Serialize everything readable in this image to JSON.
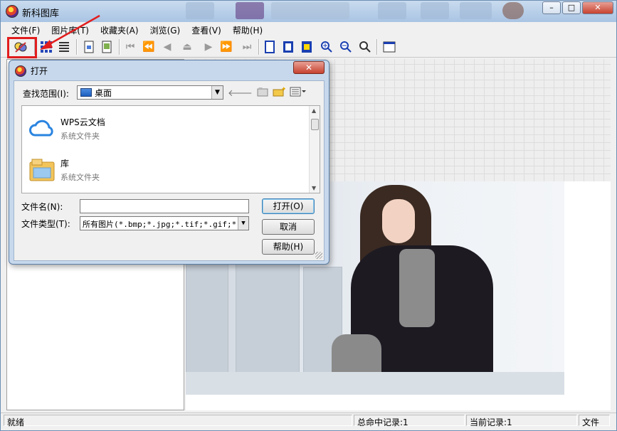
{
  "window": {
    "title": "新科图库",
    "controls": {
      "minimize": "–",
      "maximize": "□",
      "close": "✕"
    }
  },
  "menu": [
    "文件(F)",
    "图片库(T)",
    "收藏夹(A)",
    "浏览(G)",
    "查看(V)",
    "帮助(H)"
  ],
  "toolbar": {
    "icons": [
      "open-icon",
      "thumbnails-icon",
      "list-view-icon",
      "doc-icon",
      "doc2-icon",
      "first-icon",
      "prev-fast-icon",
      "prev-icon",
      "stop-icon",
      "next-icon",
      "next-fast-icon",
      "last-icon",
      "page-icon",
      "page-b-icon",
      "page-c-icon",
      "zoom-in-icon",
      "zoom-out-icon",
      "zoom-icon",
      "screen-icon"
    ]
  },
  "dialog": {
    "title": "打开",
    "close": "✕",
    "look_in_label": "查找范围(I):",
    "look_in_value": "桌面",
    "items": [
      {
        "name": "WPS云文档",
        "type": "系统文件夹",
        "icon": "cloud-icon"
      },
      {
        "name": "库",
        "type": "系统文件夹",
        "icon": "library-folder-icon"
      }
    ],
    "filename_label": "文件名(N):",
    "filename_value": "",
    "filetype_label": "文件类型(T):",
    "filetype_value": "所有图片(*.bmp;*.jpg;*.tif;*.gif;*.p",
    "open_button": "打开(O)",
    "cancel_button": "取消",
    "help_button": "帮助(H)"
  },
  "status": {
    "ready": "就绪",
    "total_records": "总命中记录:1",
    "current_record": "当前记录:1",
    "mode": "文件"
  },
  "colors": {
    "highlight": "#e21d1d",
    "title_bar": "#b9d0ea",
    "dialog_frame": "#c7d8ec"
  }
}
